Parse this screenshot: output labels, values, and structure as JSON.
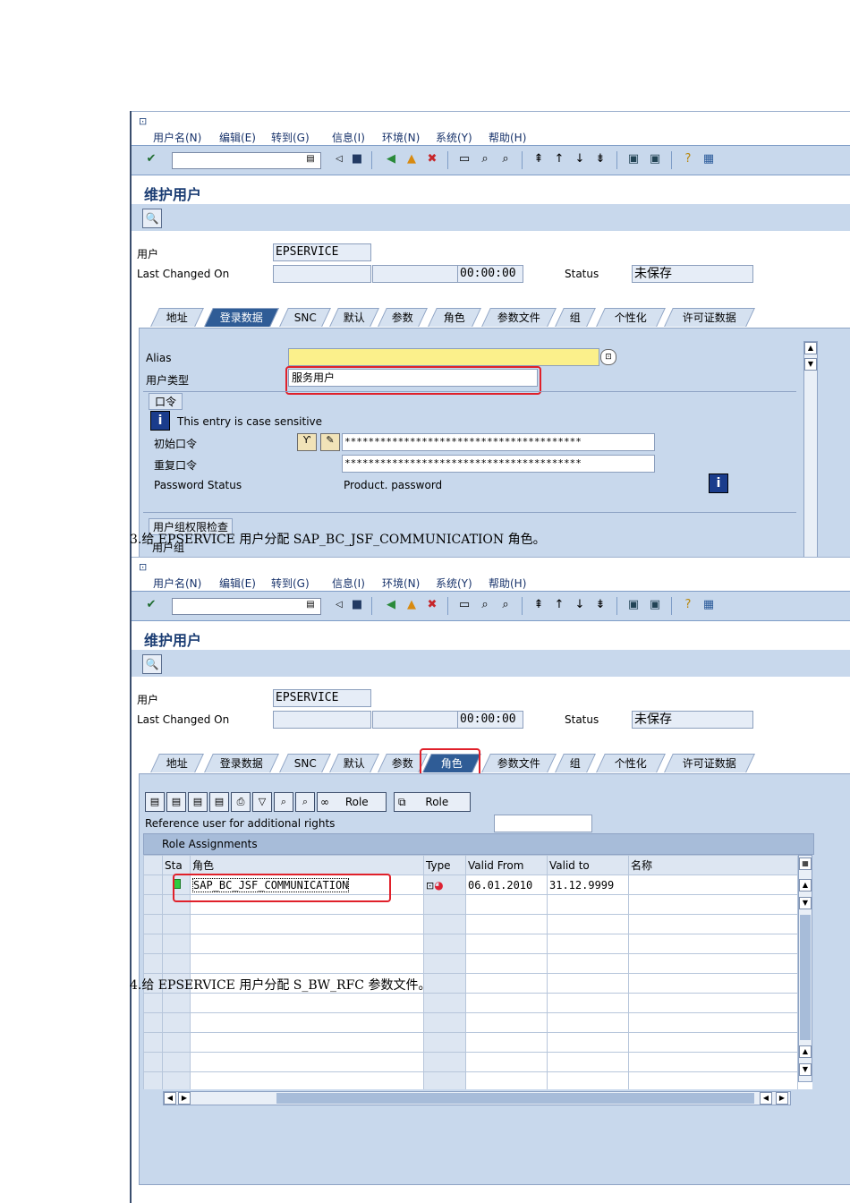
{
  "screen1": {
    "menu": [
      "用户名(N)",
      "编辑(E)",
      "转到(G)",
      "信息(I)",
      "环境(N)",
      "系统(Y)",
      "帮助(H)"
    ],
    "title": "维护用户",
    "user_label": "用户",
    "user_value": "EPSERVICE",
    "last_changed_label": "Last Changed On",
    "time_value": "00:00:00",
    "status_label": "Status",
    "status_value": "未保存",
    "tabs": [
      "地址",
      "登录数据",
      "SNC",
      "默认",
      "参数",
      "角色",
      "参数文件",
      "组",
      "个性化",
      "许可证数据"
    ],
    "active_tab": "登录数据",
    "alias_label": "Alias",
    "user_type_label": "用户类型",
    "user_type_value": "服务用户",
    "password_section": "口令",
    "case_sensitive": "This entry is case sensitive",
    "initial_pw_label": "初始口令",
    "initial_pw_value": "****************************************",
    "repeat_pw_label": "重复口令",
    "repeat_pw_value": "****************************************",
    "pw_status_label": "Password Status",
    "pw_status_value": "Product. password",
    "group_section": "用户组权限检查",
    "group_label": "用户组"
  },
  "note3": "3.给 EPSERVICE 用户分配 SAP_BC_JSF_COMMUNICATION 角色。",
  "screen2": {
    "menu": [
      "用户名(N)",
      "编辑(E)",
      "转到(G)",
      "信息(I)",
      "环境(N)",
      "系统(Y)",
      "帮助(H)"
    ],
    "title": "维护用户",
    "user_label": "用户",
    "user_value": "EPSERVICE",
    "last_changed_label": "Last Changed On",
    "time_value": "00:00:00",
    "status_label": "Status",
    "status_value": "未保存",
    "tabs": [
      "地址",
      "登录数据",
      "SNC",
      "默认",
      "参数",
      "角色",
      "参数文件",
      "组",
      "个性化",
      "许可证数据"
    ],
    "active_tab": "角色",
    "role_btn1": "Role",
    "role_btn2": "Role",
    "reference_label": "Reference user for additional rights",
    "assign_title": "Role Assignments",
    "columns": [
      "Sta",
      "角色",
      "Type",
      "Valid From",
      "Valid to",
      "名称"
    ],
    "row": {
      "role": "SAP_BC_JSF_COMMUNICATION",
      "from": "06.01.2010",
      "to": "31.12.9999",
      "name": ""
    }
  },
  "note4": "4.给 EPSERVICE 用户分配 S_BW_RFC 参数文件。"
}
